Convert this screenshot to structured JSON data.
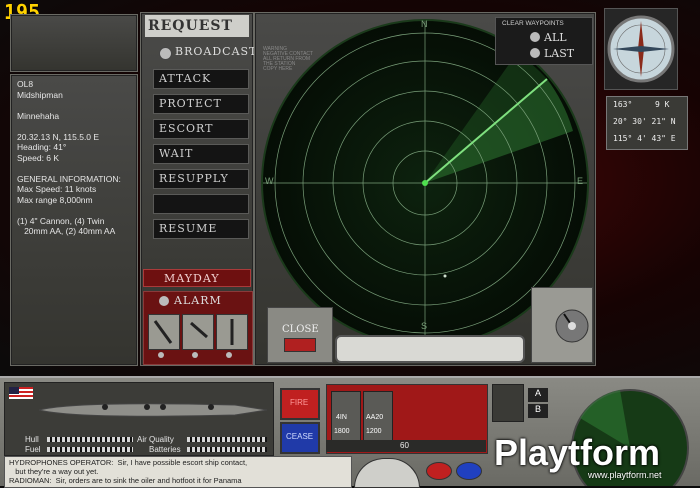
{
  "hud": {
    "counter": "195"
  },
  "unit_info": {
    "lines": [
      "OL8",
      "Midshipman",
      "",
      "Minnehaha",
      "",
      "20.32.13 N, 115.5.0 E",
      "Heading: 41°",
      "Speed: 6 K",
      "",
      "GENERAL INFORMATION:",
      "Max Speed: 11 knots",
      "Max range 8,000nm",
      "",
      "(1) 4\" Cannon, (4) Twin",
      "   20mm AA, (2) 40mm AA"
    ]
  },
  "request_menu": {
    "title": "REQUEST",
    "broadcast": "BROADCAST",
    "buttons": [
      "ATTACK",
      "PROTECT",
      "ESCORT",
      "WAIT",
      "RESUPPLY",
      "",
      "RESUME"
    ],
    "mayday": "MAYDAY",
    "alarm": "ALARM"
  },
  "radar": {
    "clear_waypoints": "CLEAR WAYPOINTS",
    "all": "ALL",
    "last": "LAST",
    "warning": [
      "WARNING",
      "NEGATIVE CONTACT",
      "ALL RETURN FROM",
      "THE STATION",
      "COPY HERE"
    ],
    "compass": {
      "n": "N",
      "s": "S",
      "e": "E",
      "w": "W"
    },
    "close": "CLOSE"
  },
  "nav_readout": {
    "heading": "163°",
    "speed": "9 K",
    "lat": "20° 30' 21\" N",
    "lon": "115° 4' 43\" E"
  },
  "bottom_console": {
    "gauges": [
      {
        "label": "Hull"
      },
      {
        "label": "Fuel"
      },
      {
        "label": "Air Quality"
      },
      {
        "label": "Batteries"
      }
    ],
    "fire": "FIRE",
    "cease": "CEASE",
    "weapons": [
      {
        "name": "4IN",
        "ammo": "1800"
      },
      {
        "name": "AA20",
        "ammo": "1200"
      }
    ],
    "ammo_count": "60",
    "toggles": [
      "A",
      "B"
    ],
    "log": [
      "HYDROPHONES OPERATOR:  Sir, I have possible escort ship contact,",
      "   but they're a way out yet.",
      "RADIOMAN:  Sir, orders are to sink the oiler and hotfoot it for Panama"
    ]
  },
  "watermark": {
    "brand": "Playtform",
    "url": "www.playtform.net"
  },
  "colors": {
    "radar_green": "#2f7a33",
    "request_red": "#6e1010",
    "counter_yellow": "#ffd200"
  }
}
